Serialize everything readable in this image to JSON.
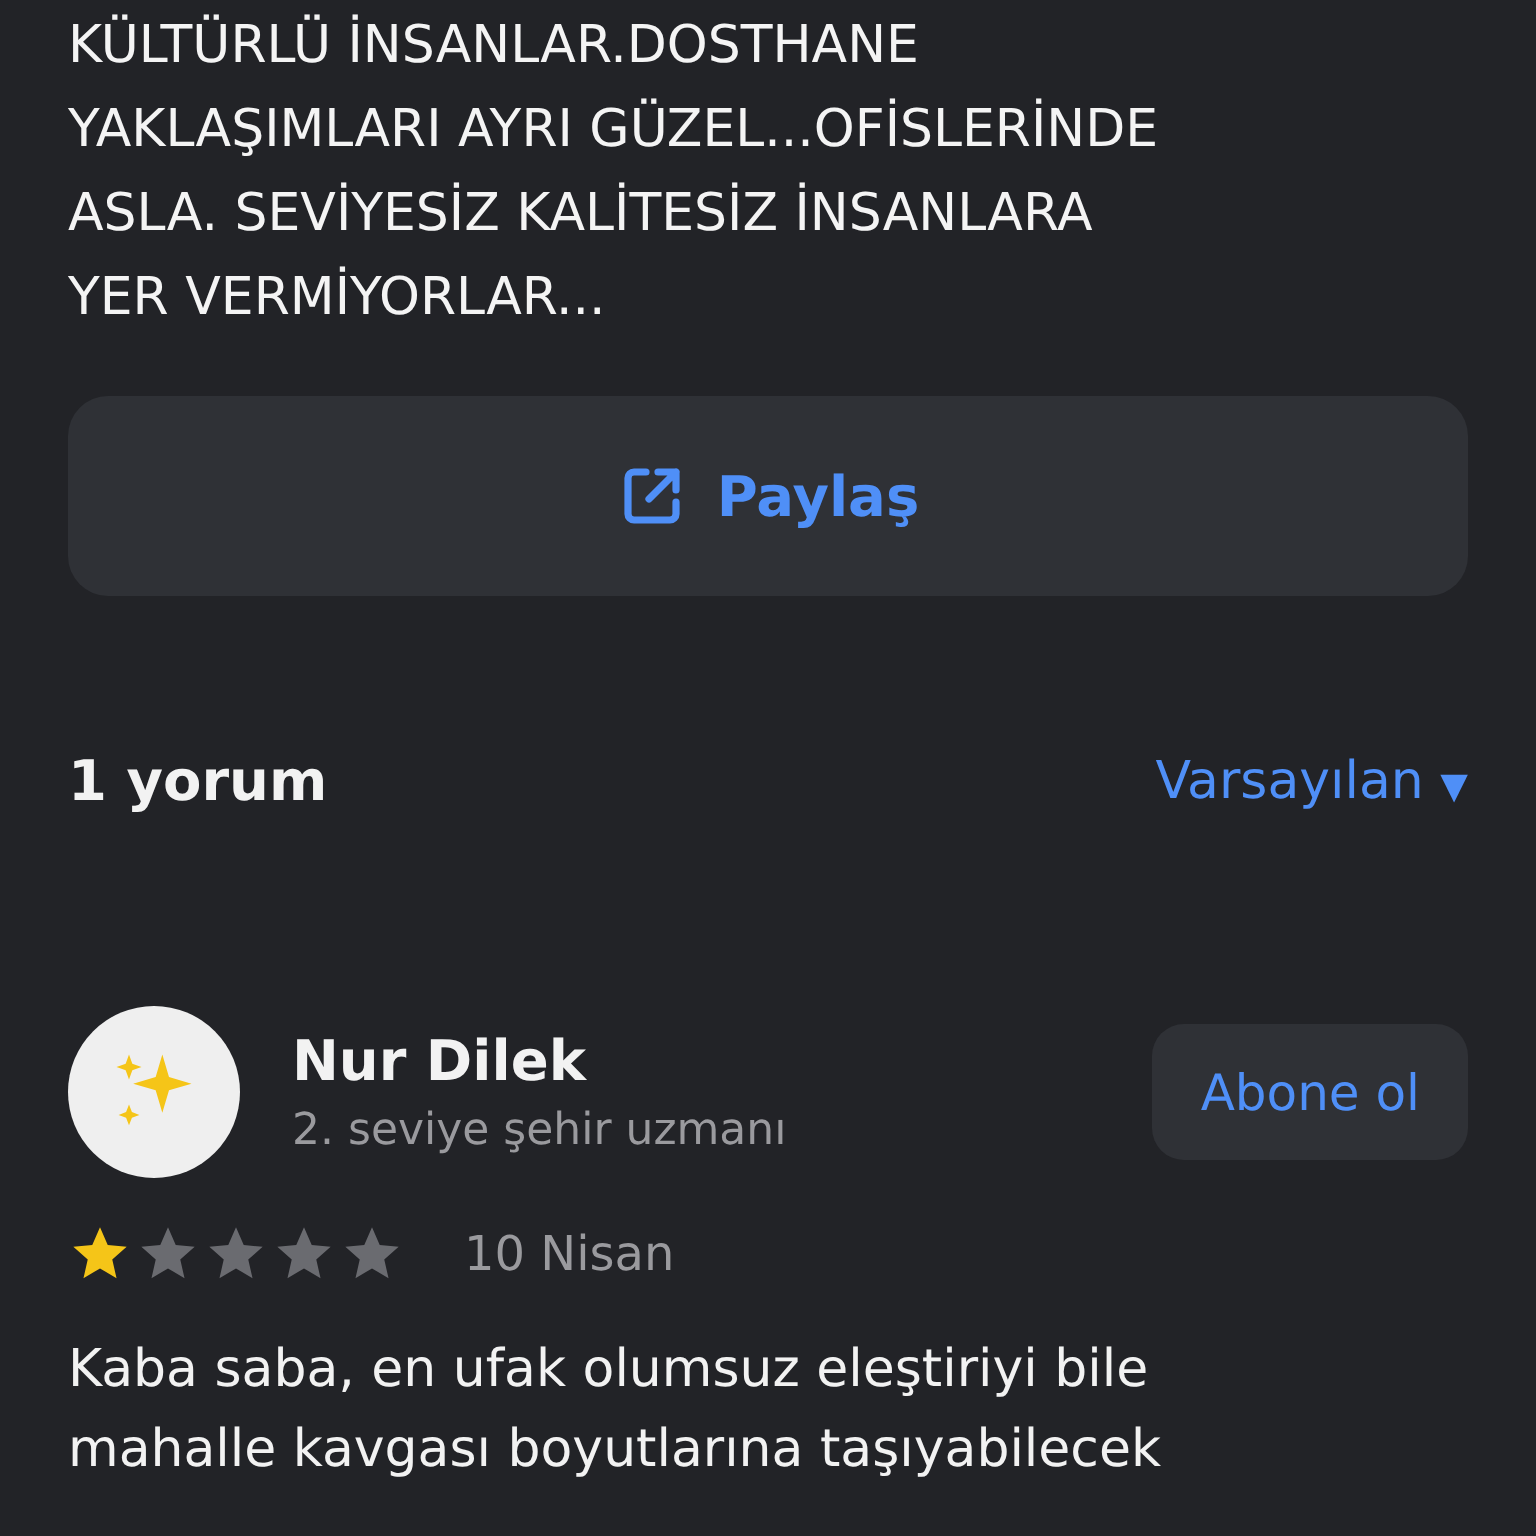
{
  "review_excerpt": "KÜLTÜRLÜ İNSANLAR.DOSTHANE\nYAKLAŞIMLARI AYRI GÜZEL...OFİSLERİNDE\nASLA. SEVİYESİZ KALİTESİZ İNSANLARA\nYER VERMİYORLAR...",
  "share_button": {
    "label": "Paylaş"
  },
  "comments": {
    "count": "1 yorum",
    "sort": "Varsayılan",
    "sort_caret": "▼"
  },
  "comment": {
    "author": "Nur Dilek",
    "level": "2. seviye şehir uzmanı",
    "subscribe": "Abone ol",
    "stars": 1,
    "date": "10 Nisan",
    "text": "Kaba saba, en ufak olumsuz eleştiriyi bile\nmahalle kavgası boyutlarına taşıyabilecek"
  }
}
